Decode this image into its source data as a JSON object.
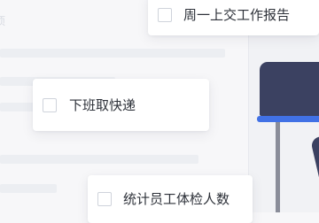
{
  "background": {
    "faded_text": "项"
  },
  "tasks": [
    {
      "label": "周一上交工作报告",
      "checked": false
    },
    {
      "label": "下班取快递",
      "checked": false
    },
    {
      "label": "统计员工体检人数",
      "checked": false
    }
  ],
  "colors": {
    "page_bg": "#f7f7f9",
    "card_bg": "#ffffff",
    "text": "#2d3139",
    "checkbox_border": "#cfd3db",
    "chair_dark": "#3b4161",
    "chair_accent": "#4171e5"
  }
}
